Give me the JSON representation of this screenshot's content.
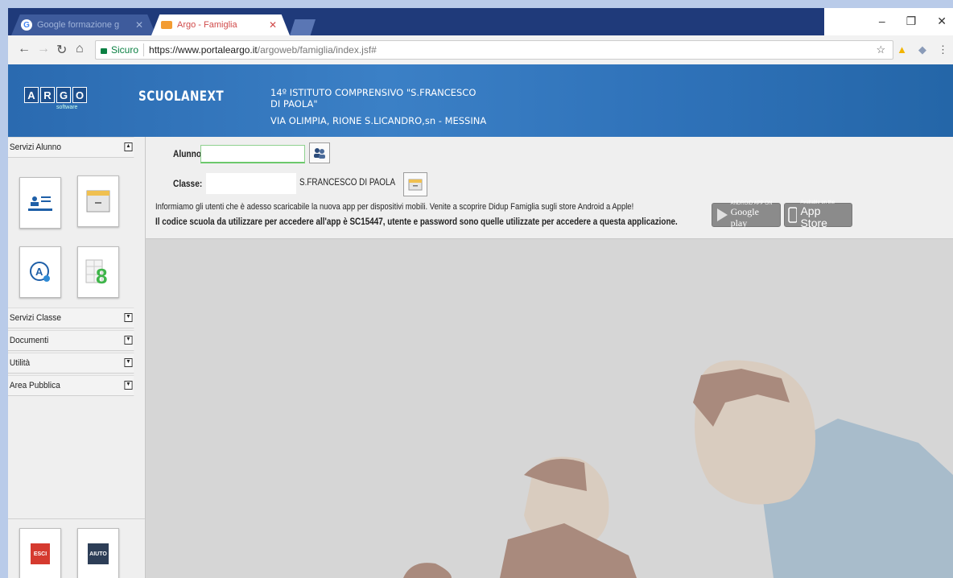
{
  "browser": {
    "tabs": [
      {
        "title": "Google formazione g",
        "icon": "google-icon",
        "active": false
      },
      {
        "title": "Argo - Famiglia",
        "icon": "argo-favicon-icon",
        "active": true
      }
    ],
    "secure_label": "Sicuro",
    "url_host": "https://www.portaleargo.it",
    "url_path": "/argoweb/famiglia/index.jsf#"
  },
  "header": {
    "logo_letters": [
      "A",
      "R",
      "G",
      "O"
    ],
    "logo_sub": "software",
    "product": "SCUOLANEXT",
    "school_line1": "14º ISTITUTO COMPRENSIVO \"S.FRANCESCO",
    "school_line2": "DI PAOLA\"",
    "school_address": "VIA OLIMPIA, RIONE S.LICANDRO,sn - MESSINA"
  },
  "sidebar": {
    "sections": [
      {
        "label": "Servizi Alunno",
        "expanded": true
      },
      {
        "label": "Servizi Classe",
        "expanded": false
      },
      {
        "label": "Documenti",
        "expanded": false
      },
      {
        "label": "Utilità",
        "expanded": false
      },
      {
        "label": "Area Pubblica",
        "expanded": false
      }
    ],
    "tiles": [
      "student-card-icon",
      "archive-box-icon",
      "grades-user-icon",
      "calendar-grade-icon"
    ],
    "bottom": {
      "esci": "ESCI",
      "aiuto": "AIUTO"
    }
  },
  "main": {
    "alunno_label": "Alunno:",
    "classe_label": "Classe:",
    "classe_value": "S.FRANCESCO DI PAOLA",
    "message_line1": "Informiamo gli utenti che è adesso scaricabile la nuova app per dispositivi mobili. Venite a scoprire Didup Famiglia sugli store Android a Apple!",
    "message_line2": "Il codice scuola da utilizzare per accedere all'app è SC15447, utente e password sono quelle utilizzate per accedere a questa applicazione.",
    "google_play_small": "ANDROID APP ON",
    "google_play": "Google play",
    "app_store_small": "Available on the",
    "app_store": "App Store"
  },
  "colors": {
    "banner": "#2f72b9",
    "esci": "#d53a2f",
    "aiuto": "#2d3e57"
  }
}
